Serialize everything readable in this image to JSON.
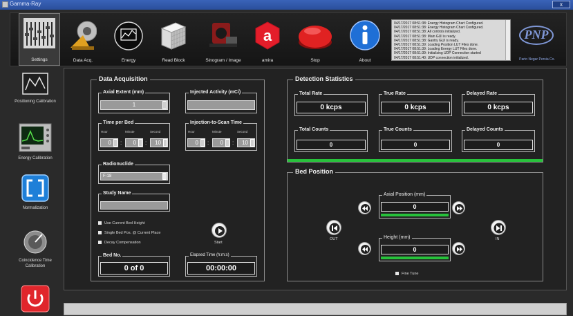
{
  "window": {
    "title": "Gamma-Ray",
    "close_label": "x"
  },
  "toolbar": {
    "settings": "Settings",
    "data_acq": "Data Acq.",
    "energy": "Energy",
    "read_block": "Read Block",
    "sinogram": "Sinogram / Image",
    "amira": "amira",
    "stop": "Stop",
    "about": "About"
  },
  "log": [
    "04/17/2017 08:51:38: Energy Histogram Chart Configured.",
    "04/17/2017 08:51:38: Energy Histogram Chart Configured.",
    "04/17/2017 08:51:38: All controls initialized.",
    "04/17/2017 08:51:38: Main GUI is ready.",
    "04/17/2017 08:51:38: Gantry GUI is ready.",
    "04/17/2017 08:51:39: Loading Position LUT Files done.",
    "04/17/2017 08:51:39: Loading Energy LUT Files done.",
    "04/17/2017 08:51:39: Initializing UDP Connection started",
    "04/17/2017 08:51:40: UDP connection initialized."
  ],
  "logo": {
    "text": "PNP",
    "caption": "Parto Negar Persia Co."
  },
  "sidebar": {
    "positioning": "Positioning Calibration",
    "energy": "Energy Calibration",
    "normalization": "Normalization",
    "coincidence": "Coincidence Time Calibration"
  },
  "acq": {
    "title": "Data Acquisition",
    "axial_extent_label": "Axial Extent (mm)",
    "axial_extent_value": "1",
    "injected_activity_label": "Injected Activity (mCi)",
    "injected_activity_value": "",
    "time_per_bed_label": "Time per Bed",
    "hour": "Hour",
    "minute": "Minute",
    "second": "Second",
    "tpb_h": "0",
    "tpb_m": "0",
    "tpb_s": "10",
    "inj_scan_label": "Injection-to-Scan Time",
    "its_h": "0",
    "its_m": "0",
    "its_s": "10",
    "colon": ":",
    "radionuclide_label": "Radionuclide",
    "radionuclide_value": "F-18",
    "study_name_label": "Study Name",
    "study_name_value": "",
    "chk_bed_height": "Use Current Bed Height",
    "chk_single_bed": "Single Bed Pos. @ Current Place",
    "chk_decay": "Decay Compensation",
    "start": "Start",
    "bed_no_label": "Bed No.",
    "bed_no_value": "0 of 0",
    "elapsed_label": "Elapsed Time (h:m:s)",
    "elapsed_value": "00:00:00"
  },
  "detection": {
    "title": "Detection Statistics",
    "total_rate_label": "Total Rate",
    "total_rate_value": "0 kcps",
    "true_rate_label": "True Rate",
    "true_rate_value": "0 kcps",
    "delayed_rate_label": "Delayed Rate",
    "delayed_rate_value": "0 kcps",
    "total_counts_label": "Total Counts",
    "total_counts_value": "0",
    "true_counts_label": "True Counts",
    "true_counts_value": "0",
    "delayed_counts_label": "Delayed Counts",
    "delayed_counts_value": "0"
  },
  "bed": {
    "title": "Bed Position",
    "axial_label": "Axial Position (mm)",
    "axial_value": "0",
    "height_label": "Height (mm)",
    "height_value": "0",
    "out": "OUT",
    "in": "IN",
    "fine_tune": "Fine Tune"
  },
  "colors": {
    "accent_green": "#27c23b",
    "title_blue": "#2a4f9c"
  }
}
